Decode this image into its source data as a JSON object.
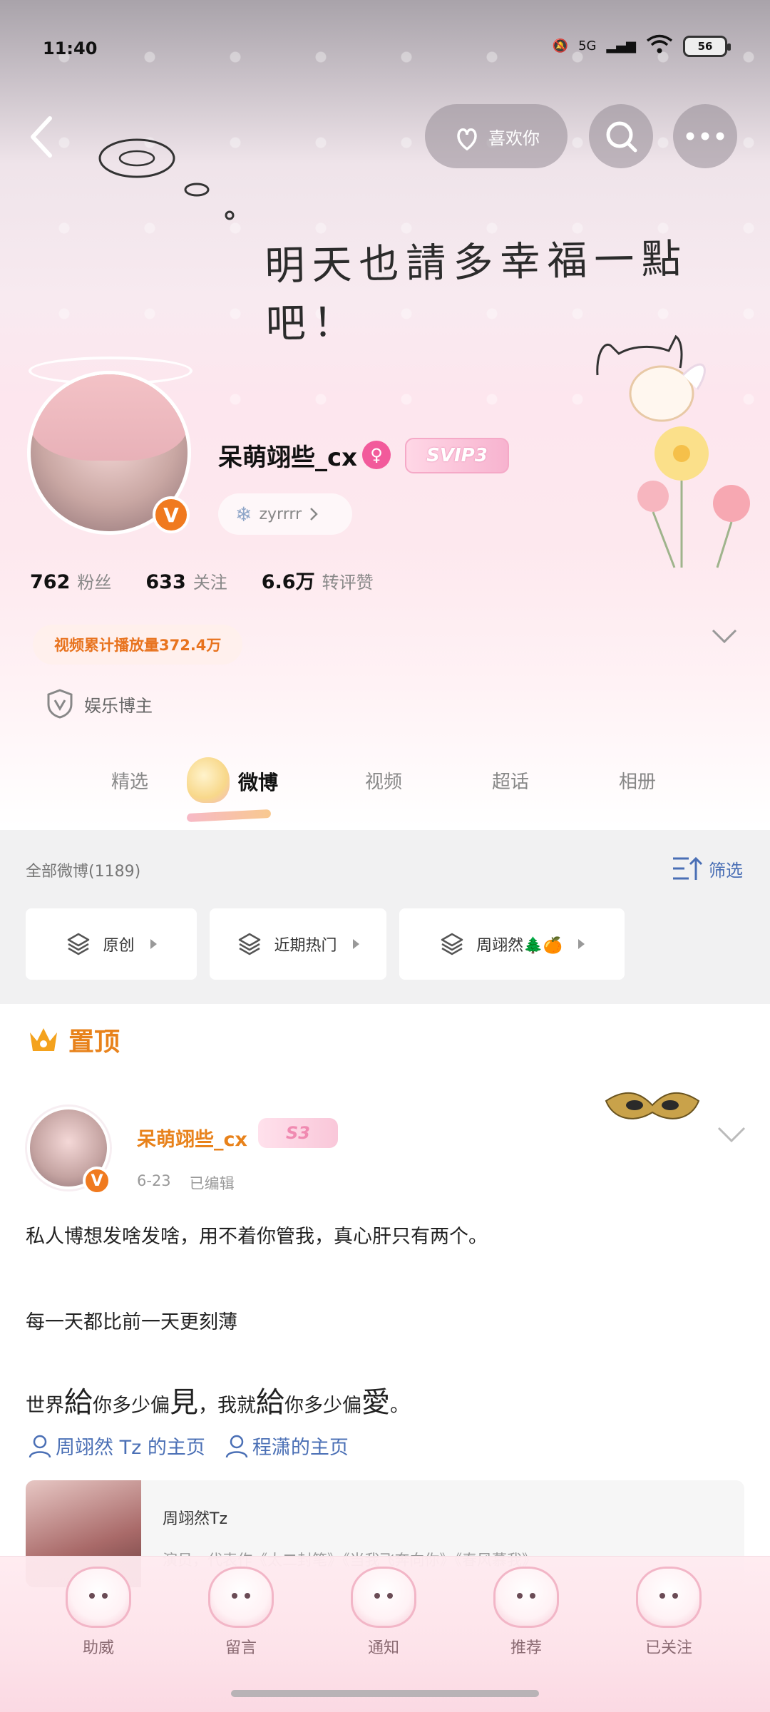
{
  "status_bar": {
    "time": "11:40",
    "network": "5G",
    "battery": "56"
  },
  "header": {
    "like_button": "喜欢你",
    "handwriting": "明天也請多幸福一點吧！",
    "username": "呆萌翊些_cx",
    "vip_badge": "SVIP3",
    "sub_tag": "zyrrrr",
    "stats": [
      {
        "value": "762",
        "label": "粉丝"
      },
      {
        "value": "633",
        "label": "关注"
      },
      {
        "value": "6.6万",
        "label": "转评赞"
      }
    ],
    "play_count": "视频累计播放量372.4万",
    "blogger_type": "娱乐博主"
  },
  "tabs": [
    {
      "label": "精选",
      "active": false
    },
    {
      "label": "微博",
      "active": true
    },
    {
      "label": "视频",
      "active": false
    },
    {
      "label": "超话",
      "active": false
    },
    {
      "label": "相册",
      "active": false
    }
  ],
  "filter": {
    "all_count": "全部微博(1189)",
    "filter_label": "筛选",
    "chips": [
      {
        "label": "原创"
      },
      {
        "label": "近期热门"
      },
      {
        "label": "周翊然🌲🍊"
      }
    ]
  },
  "post": {
    "pinned_label": "置顶",
    "author": "呆萌翊些_cx",
    "badge": "S3",
    "date": "6-23",
    "edited": "已编辑",
    "line1": "私人博想发啥发啥，用不着你管我，真心肝只有两个。",
    "line2": "每一天都比前一天更刻薄",
    "line3_parts": [
      "世界",
      "給",
      "你多少偏",
      "見",
      "，我就",
      "給",
      "你多少偏",
      "愛",
      "。"
    ],
    "links": [
      "周翊然 Tz 的主页",
      "程潇的主页"
    ],
    "card": {
      "title": "周翊然Tz",
      "desc": "演员，代表作《太二封笔》《当我飞奔向你》《春风慕我》"
    }
  },
  "bottom_nav": [
    {
      "label": "助威"
    },
    {
      "label": "留言"
    },
    {
      "label": "通知"
    },
    {
      "label": "推荐"
    },
    {
      "label": "已关注"
    }
  ],
  "colors": {
    "accent_orange": "#e8821b",
    "link_blue": "#4a6fb5",
    "gender_pink": "#f25a9b",
    "verified_orange": "#f07a1f"
  }
}
